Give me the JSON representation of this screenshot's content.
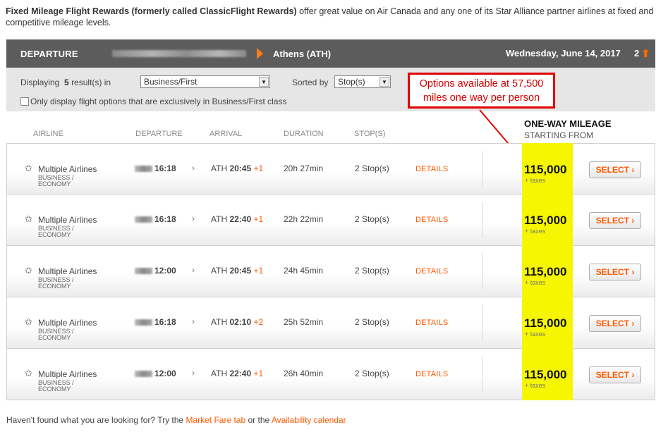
{
  "intro": {
    "bold": "Fixed Mileage Flight Rewards (formerly called ClassicFlight Rewards)",
    "text": " offer great value on Air Canada and any one of its Star Alliance partner airlines at fixed and competitive mileage levels."
  },
  "departure_bar": {
    "label": "DEPARTURE",
    "destination": "Athens (ATH)",
    "date": "Wednesday, June 14, 2017",
    "step": "2"
  },
  "filter": {
    "displaying": "Displaying",
    "count": "5",
    "results_in": "result(s) in",
    "cabin_select": "Business/First",
    "sorted_by": "Sorted by",
    "sort_select": "Stop(s)",
    "checkbox_label": "Only display flight options that are exclusively in Business/First class"
  },
  "callout": {
    "line1": "Options available at 57,500",
    "line2": "miles one way per person"
  },
  "mileage_header": {
    "title": "ONE-WAY MILEAGE",
    "subtitle": "STARTING FROM"
  },
  "columns": [
    "AIRLINE",
    "DEPARTURE",
    "ARRIVAL",
    "DURATION",
    "STOP(S)"
  ],
  "rows": [
    {
      "airline": "Multiple Airlines",
      "cabin1": "BUSINESS /",
      "cabin2": "ECONOMY",
      "dep": "16:18",
      "arr_code": "ATH",
      "arr_time": "20:45",
      "plus": "+1",
      "duration": "20h 27min",
      "stops": "2 Stop(s)",
      "details": "DETAILS",
      "miles": "115,000",
      "taxes": "+ taxes",
      "select": "SELECT ›"
    },
    {
      "airline": "Multiple Airlines",
      "cabin1": "BUSINESS /",
      "cabin2": "ECONOMY",
      "dep": "16:18",
      "arr_code": "ATH",
      "arr_time": "22:40",
      "plus": "+1",
      "duration": "22h 22min",
      "stops": "2 Stop(s)",
      "details": "DETAILS",
      "miles": "115,000",
      "taxes": "+ taxes",
      "select": "SELECT ›"
    },
    {
      "airline": "Multiple Airlines",
      "cabin1": "BUSINESS /",
      "cabin2": "ECONOMY",
      "dep": "12:00",
      "arr_code": "ATH",
      "arr_time": "20:45",
      "plus": "+1",
      "duration": "24h 45min",
      "stops": "2 Stop(s)",
      "details": "DETAILS",
      "miles": "115,000",
      "taxes": "+ taxes",
      "select": "SELECT ›"
    },
    {
      "airline": "Multiple Airlines",
      "cabin1": "BUSINESS /",
      "cabin2": "ECONOMY",
      "dep": "16:18",
      "arr_code": "ATH",
      "arr_time": "02:10",
      "plus": "+2",
      "duration": "25h 52min",
      "stops": "2 Stop(s)",
      "details": "DETAILS",
      "miles": "115,000",
      "taxes": "+ taxes",
      "select": "SELECT ›"
    },
    {
      "airline": "Multiple Airlines",
      "cabin1": "BUSINESS /",
      "cabin2": "ECONOMY",
      "dep": "12:00",
      "arr_code": "ATH",
      "arr_time": "22:40",
      "plus": "+1",
      "duration": "26h 40min",
      "stops": "2 Stop(s)",
      "details": "DETAILS",
      "miles": "115,000",
      "taxes": "+ taxes",
      "select": "SELECT ›"
    }
  ],
  "footer": {
    "text1": "Haven't found what you are looking for? Try the ",
    "link1": "Market Fare tab",
    "text2": " or the ",
    "link2": "Availability calendar"
  },
  "colors": {
    "accent": "#ff5a00",
    "highlight": "#f6f600",
    "callout_red": "#e00000",
    "header_bar": "#5c5c5c"
  }
}
